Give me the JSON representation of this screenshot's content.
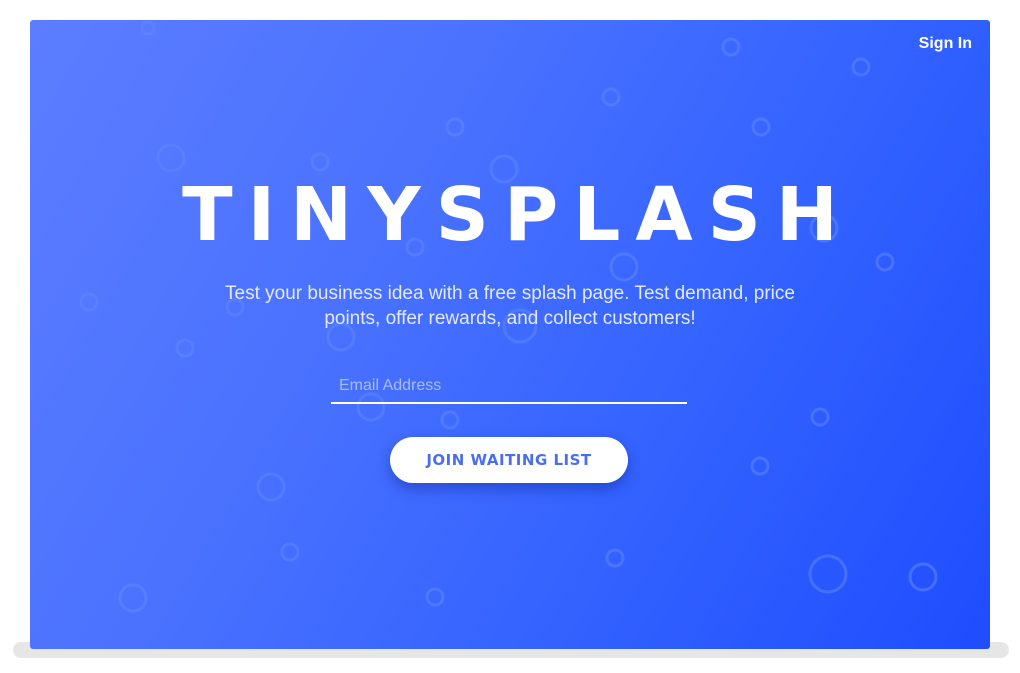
{
  "header": {
    "signin_label": "Sign In"
  },
  "hero": {
    "title": "TINYSPLASH",
    "subtitle": "Test your business idea with a free splash page. Test demand, price points, offer rewards, and collect customers!"
  },
  "form": {
    "email_placeholder": "Email Address",
    "email_value": "",
    "join_label": "JOIN WAITING LIST"
  },
  "colors": {
    "gradient_start": "#5c7dff",
    "gradient_end": "#1f4dff",
    "button_text": "#4b6df0",
    "bubble": "#5f86ff"
  }
}
